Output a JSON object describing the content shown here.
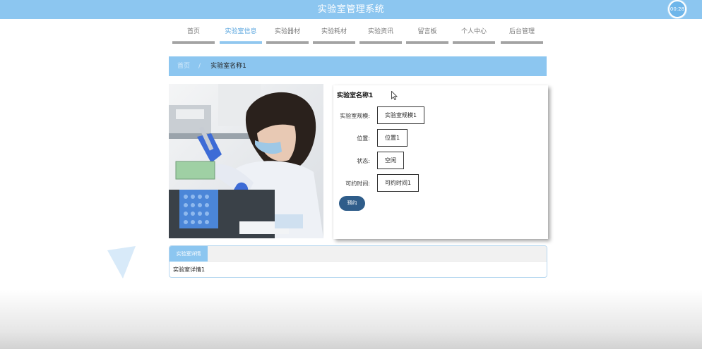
{
  "header": {
    "title": "实验室管理系统",
    "timer": "00:28"
  },
  "nav": {
    "items": [
      {
        "label": "首页",
        "active": false
      },
      {
        "label": "实验室信息",
        "active": true
      },
      {
        "label": "实验器材",
        "active": false
      },
      {
        "label": "实验耗材",
        "active": false
      },
      {
        "label": "实验资讯",
        "active": false
      },
      {
        "label": "留言板",
        "active": false
      },
      {
        "label": "个人中心",
        "active": false
      },
      {
        "label": "后台管理",
        "active": false
      }
    ]
  },
  "breadcrumb": {
    "home": "首页",
    "separator": "/",
    "current": "实验室名称1"
  },
  "lab": {
    "name": "实验室名称1",
    "fields": [
      {
        "label": "实验室规模:",
        "value": "实验室规模1"
      },
      {
        "label": "位置:",
        "value": "位置1"
      },
      {
        "label": "状态:",
        "value": "空闲"
      },
      {
        "label": "可约时间:",
        "value": "可约时间1"
      }
    ],
    "reserve_label": "预约"
  },
  "detail": {
    "tab_label": "实验室详情",
    "content": "实验室详情1"
  },
  "colors": {
    "primary": "#8cc6f0",
    "button": "#2f5d8a"
  }
}
